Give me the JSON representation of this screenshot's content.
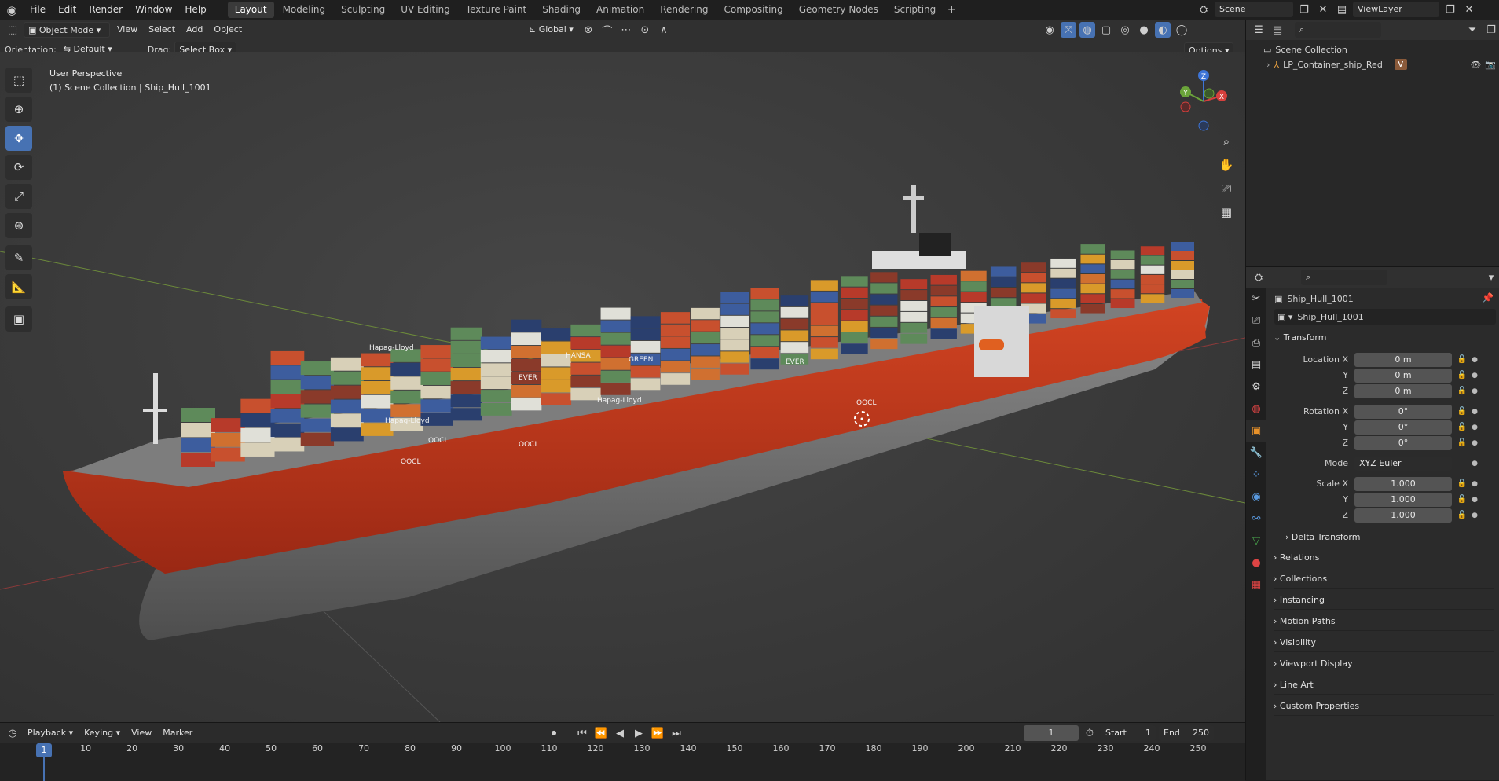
{
  "menu": [
    "File",
    "Edit",
    "Render",
    "Window",
    "Help"
  ],
  "workspaces": [
    "Layout",
    "Modeling",
    "Sculpting",
    "UV Editing",
    "Texture Paint",
    "Shading",
    "Animation",
    "Rendering",
    "Compositing",
    "Geometry Nodes",
    "Scripting"
  ],
  "active_workspace": "Layout",
  "scene": "Scene",
  "view_layer": "ViewLayer",
  "header": {
    "mode": "Object Mode",
    "view": "View",
    "select": "Select",
    "add": "Add",
    "object": "Object",
    "transform": "Global"
  },
  "tool_settings": {
    "orientation_label": "Orientation:",
    "orientation": "Default",
    "drag_label": "Drag:",
    "drag": "Select Box",
    "options": "Options"
  },
  "viewport": {
    "perspective": "User Perspective",
    "context": "(1) Scene Collection | Ship_Hull_1001"
  },
  "outliner": {
    "root": "Scene Collection",
    "items": [
      {
        "name": "LP_Container_ship_Red"
      }
    ]
  },
  "properties": {
    "object_name": "Ship_Hull_1001",
    "data_name": "Ship_Hull_1001",
    "transform_label": "Transform",
    "location": {
      "label": "Location X",
      "x": "0 m",
      "y": "0 m",
      "z": "0 m"
    },
    "rotation": {
      "label": "Rotation X",
      "x": "0°",
      "y": "0°",
      "z": "0°"
    },
    "mode_label": "Mode",
    "mode": "XYZ Euler",
    "scale": {
      "label": "Scale X",
      "x": "1.000",
      "y": "1.000",
      "z": "1.000"
    },
    "axis_y": "Y",
    "axis_z": "Z",
    "delta": "Delta Transform",
    "sections": [
      "Relations",
      "Collections",
      "Instancing",
      "Motion Paths",
      "Visibility",
      "Viewport Display",
      "Line Art",
      "Custom Properties"
    ]
  },
  "timeline": {
    "playback": "Playback",
    "keying": "Keying",
    "view": "View",
    "marker": "Marker",
    "current": "1",
    "start_label": "Start",
    "start": "1",
    "end_label": "End",
    "end": "250",
    "ticks": [
      "1",
      "10",
      "20",
      "30",
      "40",
      "50",
      "60",
      "70",
      "80",
      "90",
      "100",
      "110",
      "120",
      "130",
      "140",
      "150",
      "160",
      "170",
      "180",
      "190",
      "200",
      "210",
      "220",
      "230",
      "240",
      "250"
    ]
  },
  "gizmo": {
    "x": "X",
    "y": "Y",
    "z": "Z"
  },
  "container_labels": [
    "Hapag-Lloyd",
    "HANSA",
    "GREEN",
    "EVER",
    "Hapag-Lloyd",
    "OOCL",
    "OOCL",
    "Hapag-Lloyd",
    "OOCL",
    "EVER",
    "OOCL"
  ],
  "colors": {
    "accent": "#4772b3",
    "hull": "#c23a1a",
    "header": "#303030"
  }
}
